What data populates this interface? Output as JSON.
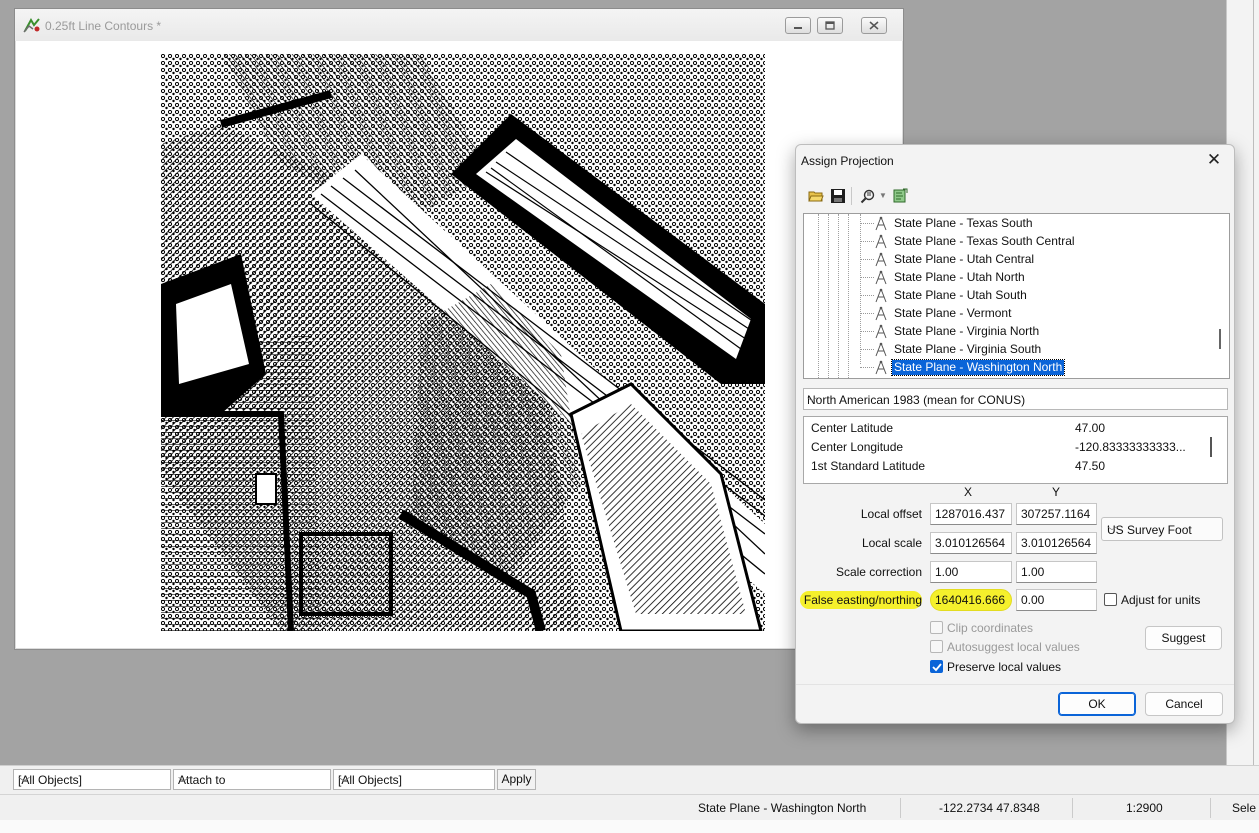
{
  "doc_window": {
    "title": "0.25ft Line Contours *"
  },
  "dialog": {
    "title": "Assign Projection",
    "close_glyph": "✕",
    "projections": [
      "State Plane - Texas South",
      "State Plane - Texas South Central",
      "State Plane - Utah Central",
      "State Plane - Utah North",
      "State Plane - Utah South",
      "State Plane - Vermont",
      "State Plane - Virginia North",
      "State Plane - Virginia South",
      "State Plane - Washington North"
    ],
    "selected_projection": "State Plane - Washington North",
    "datum": "North American 1983 (mean for CONUS)",
    "parameters": [
      {
        "name": "Center Latitude",
        "value": "47.00"
      },
      {
        "name": "Center Longitude",
        "value": "-120.83333333333..."
      },
      {
        "name": "1st Standard Latitude",
        "value": "47.50"
      }
    ],
    "col_x": "X",
    "col_y": "Y",
    "local_offset_label": "Local offset",
    "local_offset_x": "1287016.437",
    "local_offset_y": "307257.1164",
    "local_scale_label": "Local scale",
    "local_scale_x": "3.010126564",
    "local_scale_y": "3.010126564",
    "units": "US Survey Foot",
    "scale_correction_label": "Scale correction",
    "scale_correction_x": "1.00",
    "scale_correction_y": "1.00",
    "false_en_label": "False easting/northing",
    "false_easting": "1640416.666",
    "false_northing": "0.00",
    "adjust_units_label": "Adjust for units",
    "clip_label": "Clip coordinates",
    "autosuggest_label": "Autosuggest local values",
    "preserve_label": "Preserve local values",
    "preserve_checked": true,
    "suggest_label": "Suggest",
    "ok_label": "OK",
    "cancel_label": "Cancel"
  },
  "filter_bar": {
    "objects_1": "[All Objects]",
    "attach": "Attach to",
    "objects_2": "[All Objects]",
    "apply": "Apply"
  },
  "status_bar": {
    "projection": "State Plane - Washington North",
    "coordinates": "-122.2734 47.8348",
    "scale": "1:2900",
    "selection_partial": "Sele"
  },
  "colors": {
    "highlight": "#f5f02c",
    "selection": "#0a64d8"
  }
}
